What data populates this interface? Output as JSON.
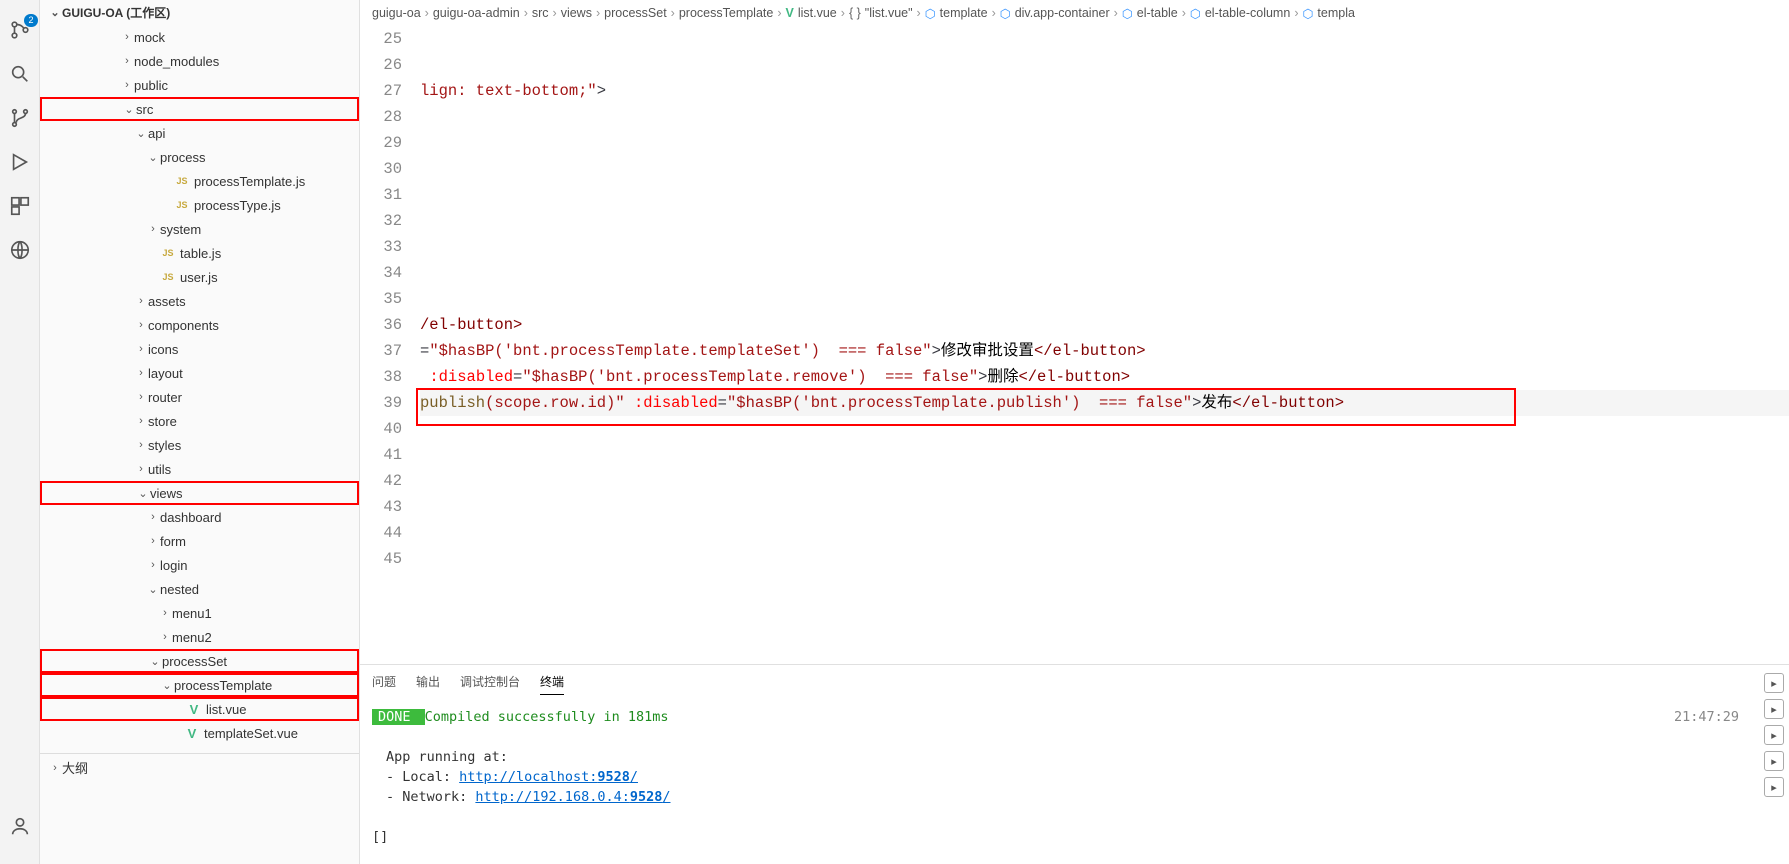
{
  "activity": {
    "badge": "2"
  },
  "sidebar": {
    "title": "GUIGU-OA (工作区)",
    "items": [
      {
        "label": "mock",
        "indent": 80,
        "chev": "›"
      },
      {
        "label": "node_modules",
        "indent": 80,
        "chev": "›"
      },
      {
        "label": "public",
        "indent": 80,
        "chev": "›"
      },
      {
        "label": "src",
        "indent": 80,
        "chev": "⌄",
        "red": true
      },
      {
        "label": "api",
        "indent": 94,
        "chev": "⌄"
      },
      {
        "label": "process",
        "indent": 106,
        "chev": "⌄"
      },
      {
        "label": "processTemplate.js",
        "indent": 120,
        "icon": "js"
      },
      {
        "label": "processType.js",
        "indent": 120,
        "icon": "js"
      },
      {
        "label": "system",
        "indent": 106,
        "chev": "›"
      },
      {
        "label": "table.js",
        "indent": 106,
        "icon": "js"
      },
      {
        "label": "user.js",
        "indent": 106,
        "icon": "js"
      },
      {
        "label": "assets",
        "indent": 94,
        "chev": "›"
      },
      {
        "label": "components",
        "indent": 94,
        "chev": "›"
      },
      {
        "label": "icons",
        "indent": 94,
        "chev": "›"
      },
      {
        "label": "layout",
        "indent": 94,
        "chev": "›"
      },
      {
        "label": "router",
        "indent": 94,
        "chev": "›"
      },
      {
        "label": "store",
        "indent": 94,
        "chev": "›"
      },
      {
        "label": "styles",
        "indent": 94,
        "chev": "›"
      },
      {
        "label": "utils",
        "indent": 94,
        "chev": "›"
      },
      {
        "label": "views",
        "indent": 94,
        "chev": "⌄",
        "red": true
      },
      {
        "label": "dashboard",
        "indent": 106,
        "chev": "›"
      },
      {
        "label": "form",
        "indent": 106,
        "chev": "›"
      },
      {
        "label": "login",
        "indent": 106,
        "chev": "›"
      },
      {
        "label": "nested",
        "indent": 106,
        "chev": "⌄"
      },
      {
        "label": "menu1",
        "indent": 118,
        "chev": "›"
      },
      {
        "label": "menu2",
        "indent": 118,
        "chev": "›"
      },
      {
        "label": "processSet",
        "indent": 106,
        "chev": "⌄",
        "red": true
      },
      {
        "label": "processTemplate",
        "indent": 118,
        "chev": "⌄",
        "red": true
      },
      {
        "label": "list.vue",
        "indent": 130,
        "icon": "vue",
        "red": true
      },
      {
        "label": "templateSet.vue",
        "indent": 130,
        "icon": "vue"
      }
    ],
    "outline": "大纲"
  },
  "breadcrumb": [
    {
      "label": "guigu-oa"
    },
    {
      "label": "guigu-oa-admin"
    },
    {
      "label": "src"
    },
    {
      "label": "views"
    },
    {
      "label": "processSet"
    },
    {
      "label": "processTemplate"
    },
    {
      "label": "list.vue",
      "ico": "vue"
    },
    {
      "label": "\"list.vue\"",
      "ico": "brace"
    },
    {
      "label": "template",
      "ico": "cube"
    },
    {
      "label": "div.app-container",
      "ico": "cube"
    },
    {
      "label": "el-table",
      "ico": "cube"
    },
    {
      "label": "el-table-column",
      "ico": "cube"
    },
    {
      "label": "templa",
      "ico": "cube"
    }
  ],
  "editor": {
    "startLine": 25,
    "lines": [
      "",
      "",
      {
        "segs": [
          {
            "t": "lign: text-bottom;\"",
            "c": "tok-str"
          },
          {
            "t": ">",
            "c": "tok-punc"
          }
        ]
      },
      "",
      "",
      "",
      "",
      "",
      "",
      "",
      "",
      {
        "segs": [
          {
            "t": "/el-button>",
            "c": "tok-tag"
          }
        ]
      },
      {
        "segs": [
          {
            "t": "=",
            "c": "tok-punc"
          },
          {
            "t": "\"$hasBP('bnt.processTemplate.templateSet')  === false\"",
            "c": "tok-str"
          },
          {
            "t": ">",
            "c": "tok-punc"
          },
          {
            "t": "修改审批设置",
            "c": "tok-txt"
          },
          {
            "t": "</el-button>",
            "c": "tok-tag"
          }
        ]
      },
      {
        "segs": [
          {
            "t": " ",
            "c": ""
          },
          {
            "t": ":disabled",
            "c": "tok-attr"
          },
          {
            "t": "=",
            "c": "tok-punc"
          },
          {
            "t": "\"$hasBP('bnt.processTemplate.remove')  === false\"",
            "c": "tok-str"
          },
          {
            "t": ">",
            "c": "tok-punc"
          },
          {
            "t": "删除",
            "c": "tok-txt"
          },
          {
            "t": "</el-button>",
            "c": "tok-tag"
          }
        ]
      },
      {
        "hl": true,
        "segs": [
          {
            "t": "publish",
            "c": "tok-fn"
          },
          {
            "t": "(scope.row.id)\" ",
            "c": "tok-str"
          },
          {
            "t": ":disabled",
            "c": "tok-attr"
          },
          {
            "t": "=",
            "c": "tok-punc"
          },
          {
            "t": "\"$hasBP('bnt.processTemplate.publish')  === false\"",
            "c": "tok-str"
          },
          {
            "t": ">",
            "c": "tok-punc"
          },
          {
            "t": "发布",
            "c": "tok-txt"
          },
          {
            "t": "</el-button>",
            "c": "tok-tag"
          }
        ]
      },
      "",
      "",
      "",
      "",
      "",
      ""
    ]
  },
  "panel": {
    "tabs": [
      "问题",
      "输出",
      "调试控制台",
      "终端"
    ],
    "activeTab": 3,
    "done": " DONE ",
    "compiled": " Compiled successfully in 181ms",
    "running": "App running at:",
    "local_lbl": "- Local:   ",
    "local_url": "http://localhost:",
    "local_port": "9528",
    "local_slash": "/",
    "net_lbl": "- Network: ",
    "net_url": "http://192.168.0.4:",
    "net_port": "9528",
    "net_slash": "/",
    "cursor": "[]",
    "time": "21:47:29"
  }
}
